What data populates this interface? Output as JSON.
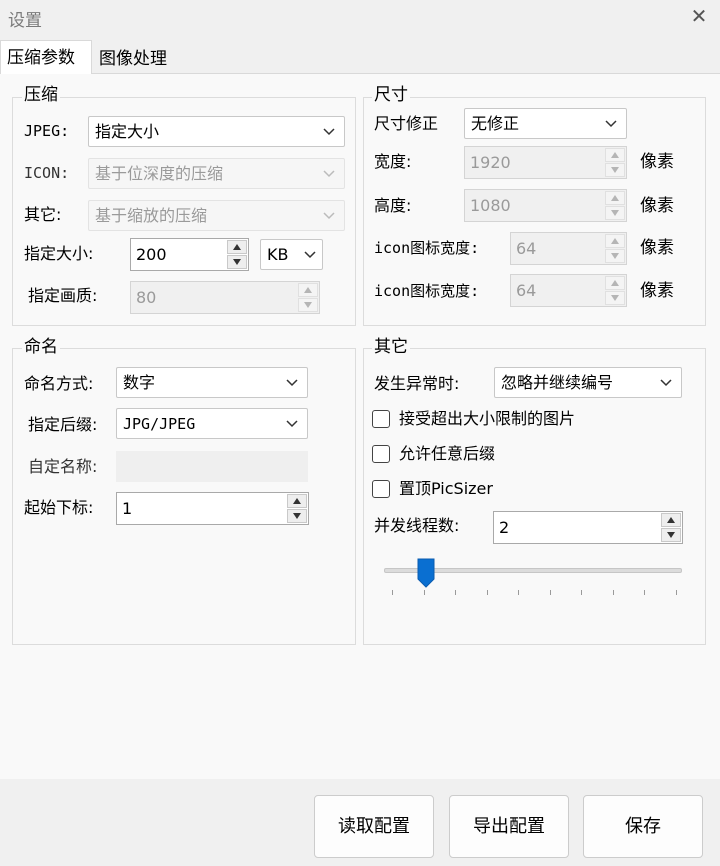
{
  "window": {
    "title": "设置",
    "close_icon": "close-icon"
  },
  "tabs": [
    {
      "label": "压缩参数"
    },
    {
      "label": "图像处理"
    }
  ],
  "compress": {
    "title": "压缩",
    "jpeg_label": "JPEG:",
    "jpeg_value": "指定大小",
    "icon_label": "ICON:",
    "icon_value": "基于位深度的压缩",
    "other_label": "其它:",
    "other_value": "基于缩放的压缩",
    "size_label": "指定大小:",
    "size_value": "200",
    "size_unit": "KB",
    "quality_label": "指定画质:",
    "quality_value": "80"
  },
  "dimension": {
    "title": "尺寸",
    "fix_label": "尺寸修正",
    "fix_value": "无修正",
    "width_label": "宽度:",
    "width_value": "1920",
    "height_label": "高度:",
    "height_value": "1080",
    "icon_w_label": "icon图标宽度:",
    "icon_w_value": "64",
    "icon_h_label": "icon图标宽度:",
    "icon_h_value": "64",
    "unit": "像素"
  },
  "naming": {
    "title": "命名",
    "mode_label": "命名方式:",
    "mode_value": "数字",
    "suffix_label": "指定后缀:",
    "suffix_value": "JPG/JPEG",
    "custom_label": "自定名称:",
    "start_label": "起始下标:",
    "start_value": "1"
  },
  "other": {
    "title": "其它",
    "error_label": "发生异常时:",
    "error_value": "忽略并继续编号",
    "chk_oversize": "接受超出大小限制的图片",
    "chk_any_suffix": "允许任意后缀",
    "chk_topmost": "置顶PicSizer",
    "threads_label": "并发线程数:",
    "threads_value": "2",
    "slider_fraction": 0.14
  },
  "footer": {
    "read_config": "读取配置",
    "export_config": "导出配置",
    "save": "保存"
  }
}
